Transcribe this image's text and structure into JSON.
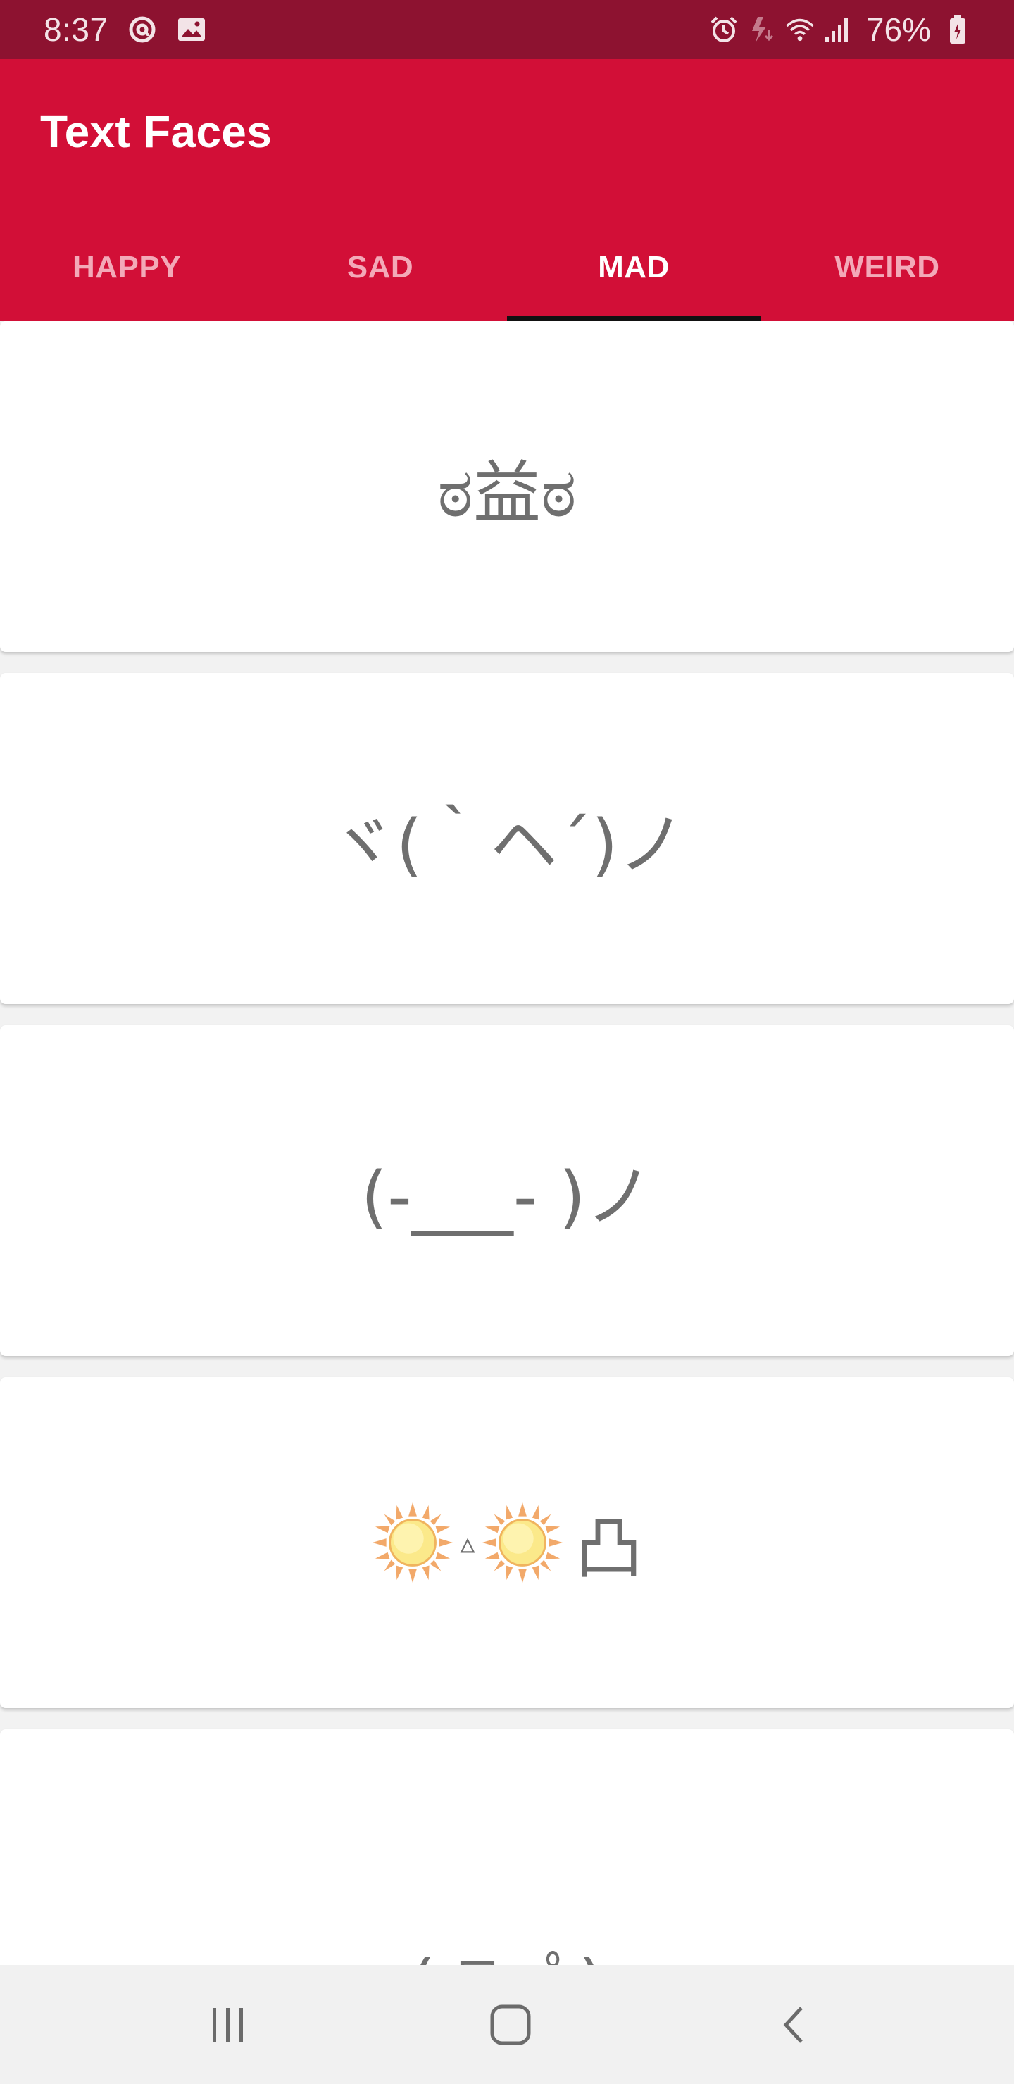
{
  "status_bar": {
    "time": "8:37",
    "battery": "76%",
    "icons_left": [
      "at-sign-icon",
      "image-icon"
    ],
    "icons_right": [
      "alarm-icon",
      "charging-icon",
      "wifi-icon",
      "signal-icon",
      "battery-icon"
    ]
  },
  "app": {
    "title": "Text Faces"
  },
  "tabs": [
    {
      "label": "HAPPY",
      "active": false
    },
    {
      "label": "SAD",
      "active": false
    },
    {
      "label": "MAD",
      "active": true
    },
    {
      "label": "WEIRD",
      "active": false
    }
  ],
  "faces": [
    {
      "text": "ಠ益ಠ"
    },
    {
      "text": "ヾ(｀ヘ´)ノ"
    },
    {
      "text": "(-___- )ノ"
    },
    {
      "text": "☀️▵☀️凸",
      "delta": "▵",
      "stamp": "凸"
    },
    {
      "text": "( ﾟдﾟ)"
    }
  ],
  "nav_bar": {
    "buttons": [
      "recents-icon",
      "home-icon",
      "back-icon"
    ]
  },
  "colors": {
    "status_bar": "#8d1230",
    "app_bar": "#d20f37",
    "tab_active": "#ffffff",
    "tab_inactive": "#f3a9b8",
    "tab_indicator": "#111111",
    "face_text": "#6f6f6f",
    "background": "#f2f2f2"
  }
}
